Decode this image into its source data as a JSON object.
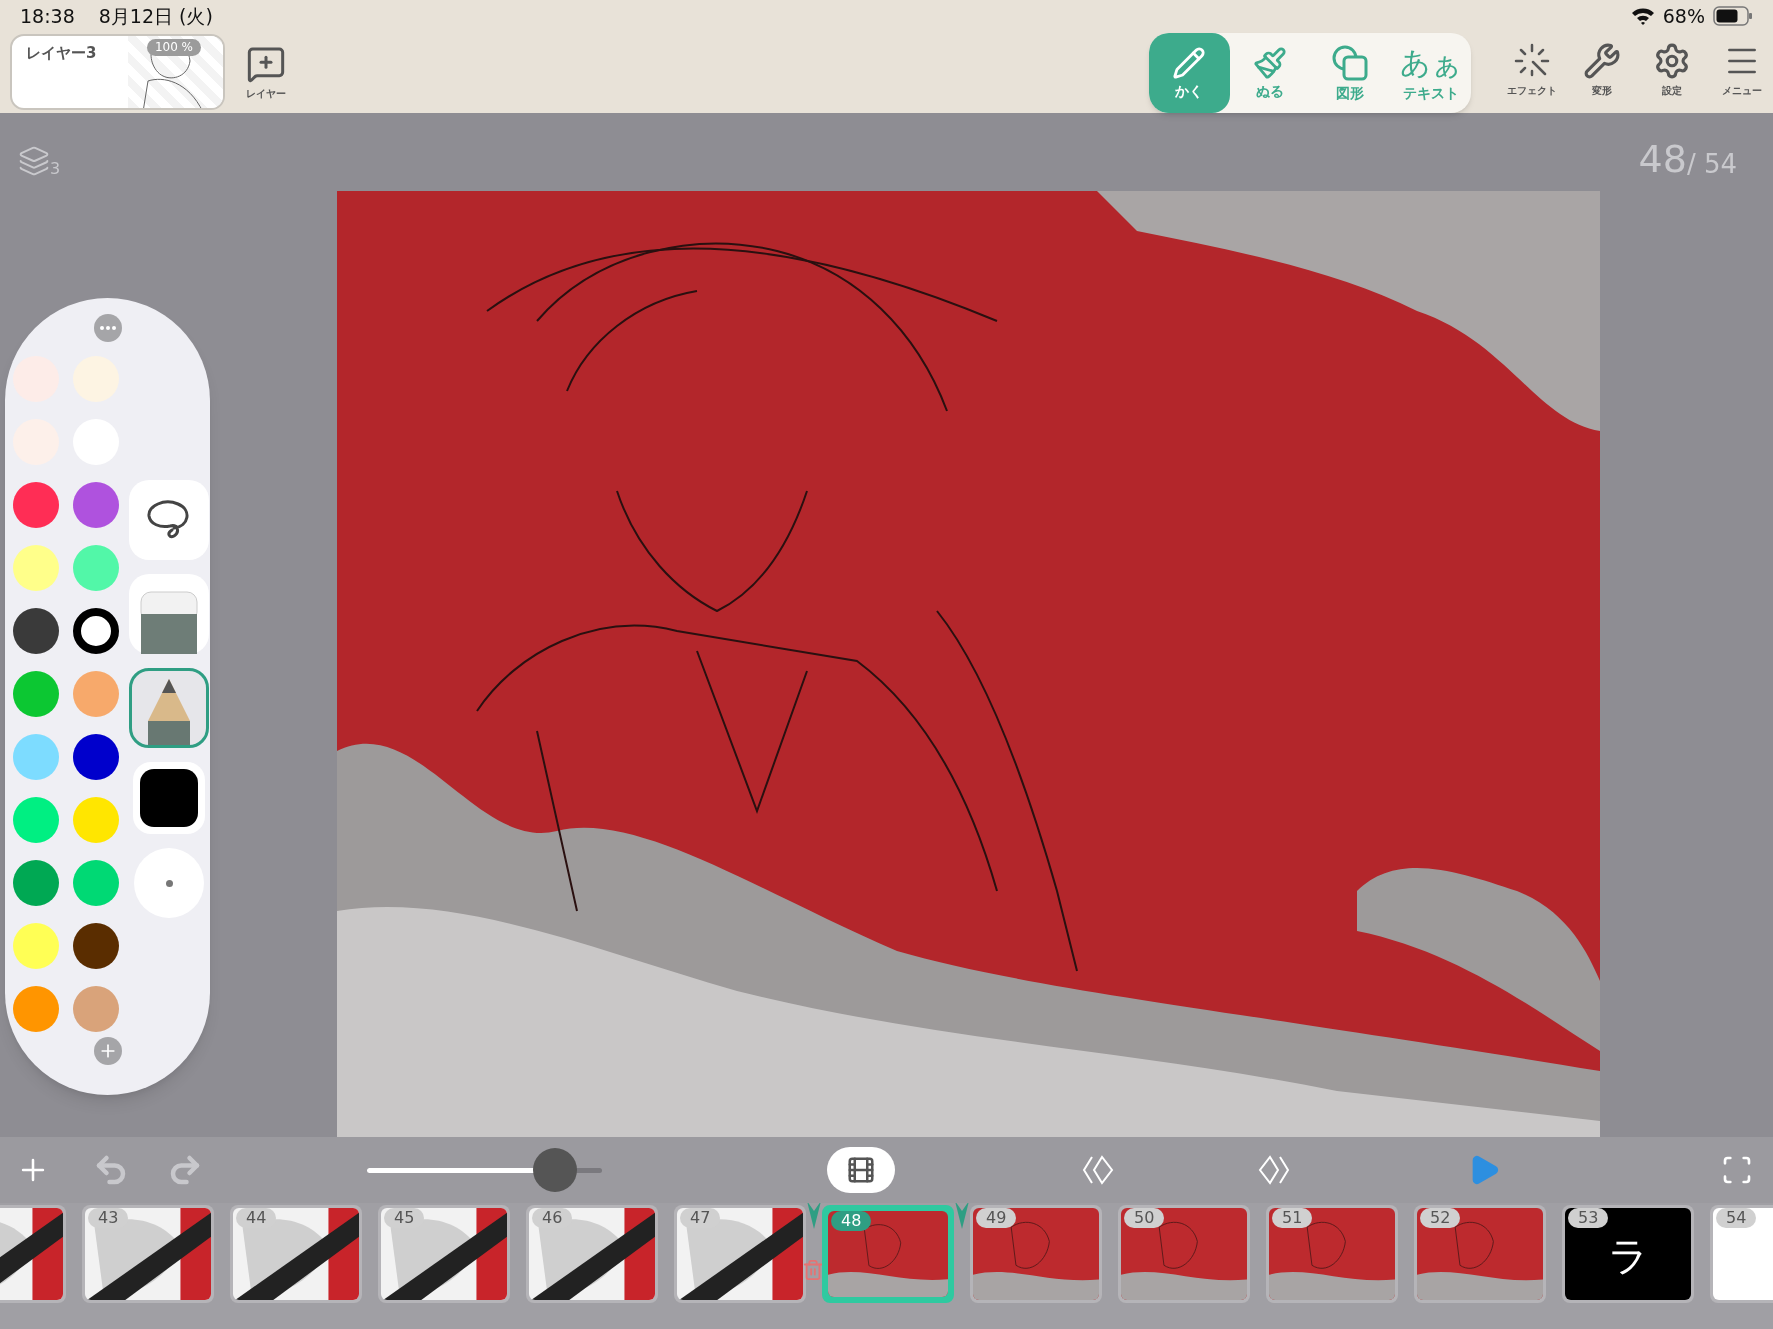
{
  "status_bar": {
    "time": "18:38",
    "date": "8月12日 (火)",
    "battery": "68%"
  },
  "layer_card": {
    "name": "レイヤー3",
    "opacity": "100 %"
  },
  "add_layer": {
    "label": "レイヤー"
  },
  "tools": [
    {
      "kind": "pen",
      "label": "かく",
      "selected": true
    },
    {
      "kind": "fill",
      "label": "ぬる",
      "selected": false
    },
    {
      "kind": "shape",
      "label": "図形",
      "selected": false
    },
    {
      "kind": "text",
      "label": "テキスト",
      "glyph": "あぁ",
      "selected": false
    }
  ],
  "actions": [
    {
      "kind": "effect",
      "label": "エフェクト"
    },
    {
      "kind": "transform",
      "label": "変形"
    },
    {
      "kind": "settings",
      "label": "設定"
    },
    {
      "kind": "menu",
      "label": "メニュー"
    }
  ],
  "layers_indicator": {
    "count": "3"
  },
  "frame_counter": {
    "current": "48",
    "total": "/ 54"
  },
  "palette": {
    "colors": [
      {
        "kind": "swatch",
        "color": "#fdece8"
      },
      {
        "kind": "swatch",
        "color": "#fdf4e3"
      },
      {
        "kind": "swatch",
        "color": "#fdf0ea"
      },
      {
        "kind": "swatch",
        "color": "#ffffff"
      },
      {
        "kind": "swatch",
        "color": "#ff2d55"
      },
      {
        "kind": "swatch",
        "color": "#af52de"
      },
      {
        "kind": "swatch",
        "color": "#ffff8a"
      },
      {
        "kind": "swatch",
        "color": "#52f7a8"
      },
      {
        "kind": "swatch",
        "color": "#3a3a3a"
      },
      {
        "kind": "outlined",
        "color": "#000000"
      },
      {
        "kind": "swatch",
        "color": "#0cc732"
      },
      {
        "kind": "swatch",
        "color": "#f7a96b"
      },
      {
        "kind": "swatch",
        "color": "#7ddcff"
      },
      {
        "kind": "swatch",
        "color": "#0000cc"
      },
      {
        "kind": "swatch",
        "color": "#00ef82"
      },
      {
        "kind": "swatch",
        "color": "#ffe600"
      },
      {
        "kind": "swatch",
        "color": "#00a853"
      },
      {
        "kind": "swatch",
        "color": "#00d974"
      },
      {
        "kind": "swatch",
        "color": "#ffff55"
      },
      {
        "kind": "swatch",
        "color": "#5a2d00"
      },
      {
        "kind": "swatch",
        "color": "#ff9500"
      },
      {
        "kind": "swatch",
        "color": "#d9a37a"
      }
    ],
    "tools": [
      {
        "kind": "lasso",
        "selected": false
      },
      {
        "kind": "eraser",
        "selected": false
      },
      {
        "kind": "pencil",
        "selected": true
      },
      {
        "kind": "color",
        "color": "#000000"
      },
      {
        "kind": "size"
      }
    ]
  },
  "zoom_slider": {
    "level": 0.8
  },
  "frames": [
    {
      "kind": "manga",
      "selected": false
    },
    {
      "kind": "manga",
      "number": "43",
      "selected": false
    },
    {
      "kind": "manga",
      "number": "44",
      "selected": false
    },
    {
      "kind": "manga",
      "number": "45",
      "selected": false
    },
    {
      "kind": "manga",
      "number": "46",
      "selected": false
    },
    {
      "kind": "manga",
      "number": "47",
      "selected": false
    },
    {
      "kind": "red",
      "number": "48",
      "selected": true
    },
    {
      "kind": "red",
      "number": "49",
      "selected": false
    },
    {
      "kind": "red",
      "number": "50",
      "selected": false
    },
    {
      "kind": "red",
      "number": "51",
      "selected": false
    },
    {
      "kind": "red",
      "number": "52",
      "selected": false
    },
    {
      "kind": "black",
      "number": "53",
      "text": "ラ",
      "selected": false
    },
    {
      "kind": "white",
      "number": "54",
      "selected": false
    }
  ]
}
